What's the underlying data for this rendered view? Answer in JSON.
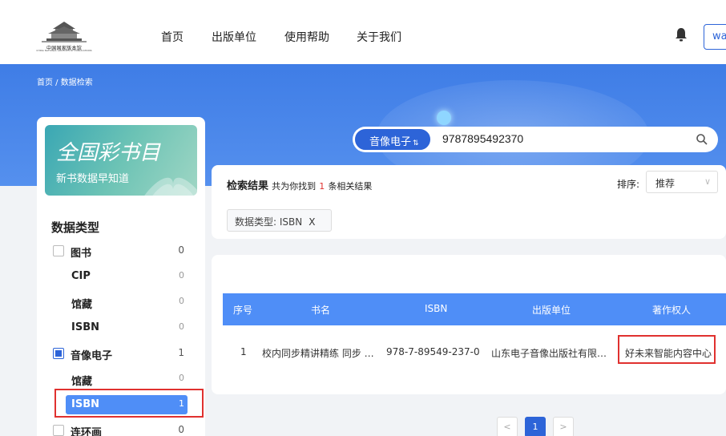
{
  "header": {
    "logo_text": "中国国家版本馆",
    "logo_sub": "CHINA NATIONAL ARCHIVES OF PUBLICATIONS",
    "nav": [
      "首页",
      "出版单位",
      "使用帮助",
      "关于我们"
    ],
    "user_button": "wa"
  },
  "breadcrumb": "首页 / 数据检索",
  "search": {
    "type": "音像电子",
    "type_mark": "⇅",
    "query": "9787895492370"
  },
  "promo": {
    "title": "全国彩书目",
    "subtitle": "新书数据早知道"
  },
  "sidebar": {
    "title": "数据类型",
    "categories": [
      {
        "label": "图书",
        "count": "0",
        "checked": false,
        "children": [
          {
            "label": "CIP",
            "count": "0"
          },
          {
            "label": "馆藏",
            "count": "0"
          },
          {
            "label": "ISBN",
            "count": "0"
          }
        ]
      },
      {
        "label": "音像电子",
        "count": "1",
        "checked": true,
        "children": [
          {
            "label": "馆藏",
            "count": "0"
          },
          {
            "label": "ISBN",
            "count": "1",
            "active": true
          }
        ]
      },
      {
        "label": "连环画",
        "count": "0",
        "checked": false,
        "children": []
      }
    ]
  },
  "results": {
    "title": "检索结果",
    "summary_prefix": "共为你找到",
    "count": "1",
    "summary_suffix": "条相关结果",
    "sort_label": "排序:",
    "sort_value": "推荐",
    "filter_tag": "数据类型: ISBN",
    "filter_close": "X"
  },
  "table": {
    "headers": [
      "序号",
      "书名",
      "ISBN",
      "出版单位",
      "著作权人"
    ],
    "rows": [
      [
        "1",
        "校内同步精讲精练 同步 …",
        "978-7-89549-237-0",
        "山东电子音像出版社有限…",
        "好未来智能内容中心"
      ]
    ]
  },
  "pagination": {
    "prev": "<",
    "current": "1",
    "next": ">"
  },
  "colors": {
    "accent": "#2d64d8",
    "table_header": "#4f8ef7",
    "highlight": "#e0312f"
  }
}
